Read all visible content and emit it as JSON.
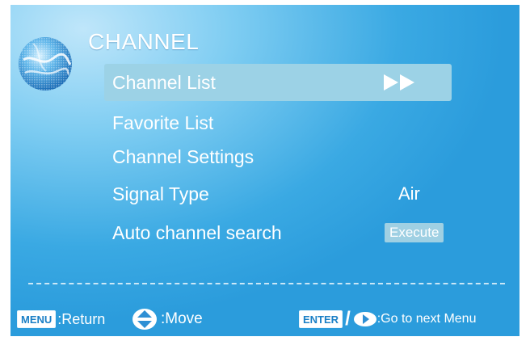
{
  "header": {
    "title": "CHANNEL",
    "icon": "globe-icon"
  },
  "menu": {
    "items": [
      {
        "label": "Channel List",
        "value": "",
        "value_icon": "fast-forward-icon",
        "selected": true
      },
      {
        "label": "Favorite List",
        "value": ""
      },
      {
        "label": "Channel Settings",
        "value": ""
      },
      {
        "label": "Signal Type",
        "value": "Air"
      },
      {
        "label": "Auto channel search",
        "value": "Execute"
      }
    ]
  },
  "footer": {
    "menu_key": "MENU",
    "return_label": ":Return",
    "move_icon": "up-down-arrows-icon",
    "move_label": ":Move",
    "enter_key": "ENTER",
    "separator": "/",
    "right_icon": "right-arrow-icon",
    "next_label": ":Go to next Menu"
  },
  "colors": {
    "background": "#2b9cdc",
    "highlight": "#9cd2e6",
    "text": "#ffffff",
    "key_text": "#1a7fc6"
  }
}
